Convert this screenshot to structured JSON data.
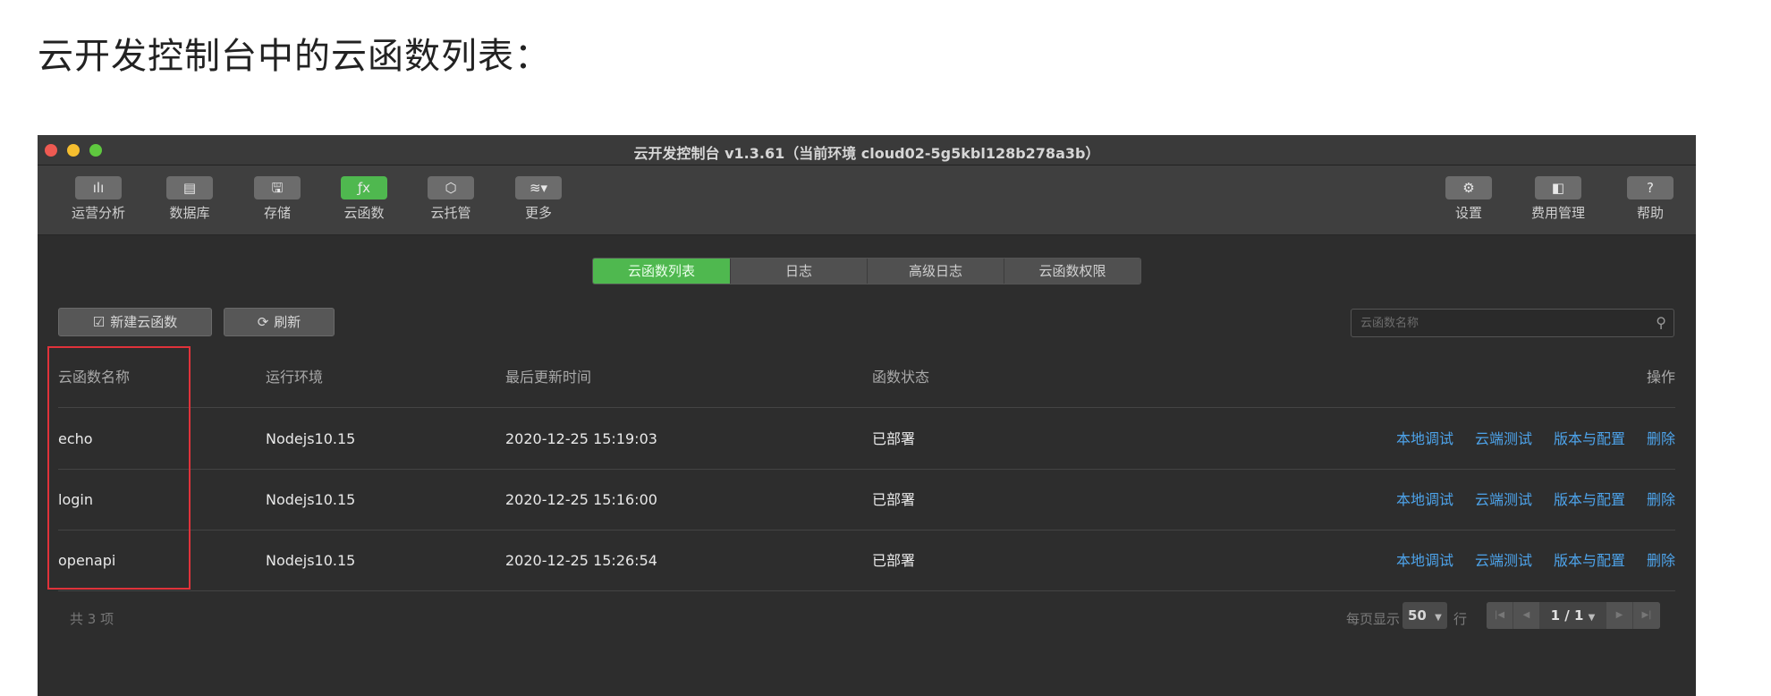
{
  "heading": "云开发控制台中的云函数列表：",
  "window": {
    "title": "云开发控制台 v1.3.61（当前环境 cloud02-5g5kbl128b278a3b）"
  },
  "toolbar": {
    "left": [
      {
        "label": "运营分析",
        "icon": "bar-chart-icon",
        "glyph": "ılı",
        "active": false
      },
      {
        "label": "数据库",
        "icon": "database-icon",
        "glyph": "▤",
        "active": false
      },
      {
        "label": "存储",
        "icon": "storage-icon",
        "glyph": "🖫",
        "active": false
      },
      {
        "label": "云函数",
        "icon": "function-icon",
        "glyph": "ƒx",
        "active": true
      },
      {
        "label": "云托管",
        "icon": "cube-icon",
        "glyph": "⬡",
        "active": false
      },
      {
        "label": "更多",
        "icon": "layers-icon",
        "glyph": "≋▾",
        "active": false
      }
    ],
    "right": [
      {
        "label": "设置",
        "icon": "gear-icon",
        "glyph": "⚙"
      },
      {
        "label": "费用管理",
        "icon": "billing-icon",
        "glyph": "◧"
      },
      {
        "label": "帮助",
        "icon": "help-icon",
        "glyph": "?"
      }
    ]
  },
  "tabs": [
    "云函数列表",
    "日志",
    "高级日志",
    "云函数权限"
  ],
  "buttons": {
    "new_label": "新建云函数",
    "refresh_label": "刷新"
  },
  "search": {
    "placeholder": "云函数名称"
  },
  "table": {
    "headers": {
      "name": "云函数名称",
      "env": "运行环境",
      "time": "最后更新时间",
      "status": "函数状态",
      "ops": "操作"
    },
    "rows": [
      {
        "name": "echo",
        "env": "Nodejs10.15",
        "time": "2020-12-25 15:19:03",
        "status": "已部署"
      },
      {
        "name": "login",
        "env": "Nodejs10.15",
        "time": "2020-12-25 15:16:00",
        "status": "已部署"
      },
      {
        "name": "openapi",
        "env": "Nodejs10.15",
        "time": "2020-12-25 15:26:54",
        "status": "已部署"
      }
    ],
    "actions": [
      "本地调试",
      "云端测试",
      "版本与配置",
      "删除"
    ]
  },
  "footer": {
    "total": "共 3 项",
    "per_page_label": "每页显示",
    "per_page": "50",
    "rows_unit": "行",
    "page_indicator": "1 / 1"
  },
  "colors": {
    "accent": "#4fb84f",
    "link": "#4da3ea",
    "highlight": "#e0323a"
  }
}
